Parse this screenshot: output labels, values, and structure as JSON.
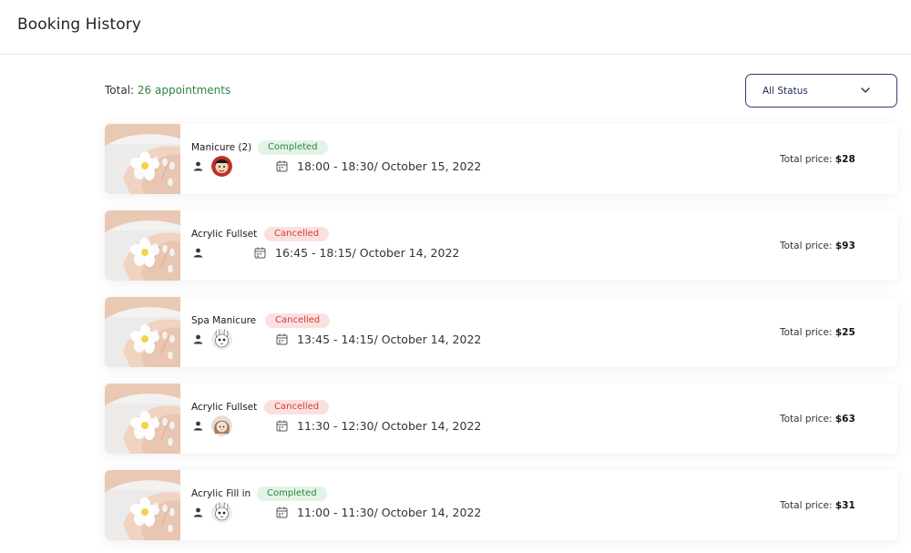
{
  "header": {
    "title": "Booking History"
  },
  "summary": {
    "total_label": "Total:",
    "total_value": "26 appointments"
  },
  "filter": {
    "selected": "All Status",
    "icon": "chevron-down-icon"
  },
  "price_label": "Total price:",
  "colors": {
    "completed": "#2e8540",
    "cancelled": "#d63a3a",
    "accent": "#2c3e7a"
  },
  "bookings": [
    {
      "service": "Manicure (2)",
      "status": "Completed",
      "time": "18:00 - 18:30/ October 15, 2022",
      "price": "$28",
      "avatar": "cartoon-avatar-red"
    },
    {
      "service": "Acrylic Fullset",
      "status": "Cancelled",
      "time": "16:45 - 18:15/ October 14, 2022",
      "price": "$93",
      "avatar": ""
    },
    {
      "service": "Spa Manicure",
      "status": "Cancelled",
      "time": "13:45 - 14:15/ October 14, 2022",
      "price": "$25",
      "avatar": "cartoon-avatar-bunny"
    },
    {
      "service": "Acrylic Fullset",
      "status": "Cancelled",
      "time": "11:30 - 12:30/ October 14, 2022",
      "price": "$63",
      "avatar": "cartoon-avatar-girl"
    },
    {
      "service": "Acrylic Fill in",
      "status": "Completed",
      "time": "11:00 - 11:30/ October 14, 2022",
      "price": "$31",
      "avatar": "cartoon-avatar-bunny"
    }
  ]
}
